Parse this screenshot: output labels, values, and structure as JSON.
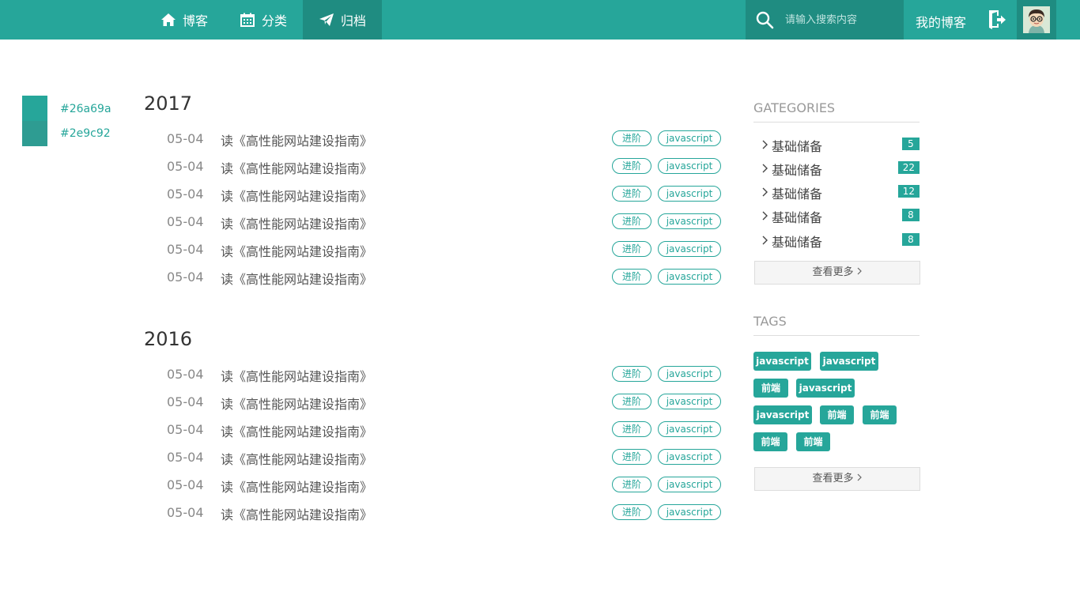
{
  "nav": {
    "items": [
      {
        "label": "博客",
        "icon": "home-icon"
      },
      {
        "label": "分类",
        "icon": "calendar-icon"
      },
      {
        "label": "归档",
        "icon": "paper-plane-icon",
        "active": true
      }
    ]
  },
  "search": {
    "placeholder": "请输入搜索内容",
    "icon": "search-icon"
  },
  "header": {
    "my_blog": "我的博客",
    "logout_icon": "logout-icon",
    "avatar": "avatar"
  },
  "swatches": [
    {
      "color": "#26a69a",
      "label": "#26a69a"
    },
    {
      "color": "#2e9c92",
      "label": "#2e9c92"
    }
  ],
  "archive": {
    "years": [
      {
        "year": "2017",
        "posts": [
          {
            "date": "05-04",
            "title": "读《高性能网站建设指南》",
            "tags": [
              "进阶",
              "javascript"
            ]
          },
          {
            "date": "05-04",
            "title": "读《高性能网站建设指南》",
            "tags": [
              "进阶",
              "javascript"
            ]
          },
          {
            "date": "05-04",
            "title": "读《高性能网站建设指南》",
            "tags": [
              "进阶",
              "javascript"
            ]
          },
          {
            "date": "05-04",
            "title": "读《高性能网站建设指南》",
            "tags": [
              "进阶",
              "javascript"
            ]
          },
          {
            "date": "05-04",
            "title": "读《高性能网站建设指南》",
            "tags": [
              "进阶",
              "javascript"
            ]
          },
          {
            "date": "05-04",
            "title": "读《高性能网站建设指南》",
            "tags": [
              "进阶",
              "javascript"
            ]
          }
        ]
      },
      {
        "year": "2016",
        "posts": [
          {
            "date": "05-04",
            "title": "读《高性能网站建设指南》",
            "tags": [
              "进阶",
              "javascript"
            ]
          },
          {
            "date": "05-04",
            "title": "读《高性能网站建设指南》",
            "tags": [
              "进阶",
              "javascript"
            ]
          },
          {
            "date": "05-04",
            "title": "读《高性能网站建设指南》",
            "tags": [
              "进阶",
              "javascript"
            ]
          },
          {
            "date": "05-04",
            "title": "读《高性能网站建设指南》",
            "tags": [
              "进阶",
              "javascript"
            ]
          },
          {
            "date": "05-04",
            "title": "读《高性能网站建设指南》",
            "tags": [
              "进阶",
              "javascript"
            ]
          },
          {
            "date": "05-04",
            "title": "读《高性能网站建设指南》",
            "tags": [
              "进阶",
              "javascript"
            ]
          }
        ]
      }
    ]
  },
  "sidebar": {
    "categories": {
      "title": "GATEGORIES",
      "items": [
        {
          "label": "基础储备",
          "count": "5"
        },
        {
          "label": "基础储备",
          "count": "22"
        },
        {
          "label": "基础储备",
          "count": "12"
        },
        {
          "label": "基础储备",
          "count": "8"
        },
        {
          "label": "基础储备",
          "count": "8"
        }
      ],
      "more": "查看更多"
    },
    "tags": {
      "title": "TAGS",
      "items": [
        "javascript",
        "javascript",
        "前端",
        "javascript",
        "javascript",
        "前端",
        "前端",
        "前端",
        "前端"
      ],
      "more": "查看更多"
    }
  },
  "colors": {
    "accent": "#26a69a",
    "accent_dark": "#1f8c81"
  }
}
